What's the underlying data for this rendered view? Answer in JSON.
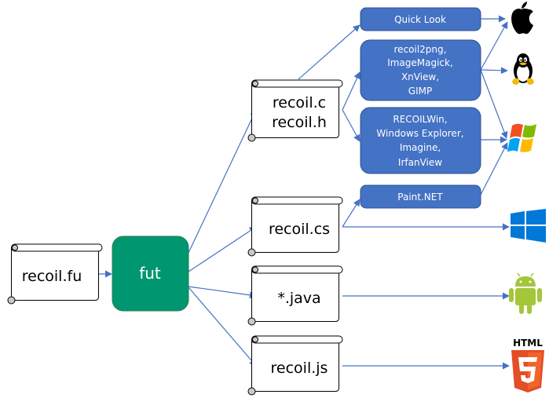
{
  "colors": {
    "arrow": "#4472c4",
    "tool_box_fill": "#4472c4",
    "tool_box_border": "#2f528f",
    "fut_fill": "#009670",
    "scroll_stroke": "#000000",
    "scroll_curl": "#c8c8c8"
  },
  "source": {
    "label": "recoil.fu"
  },
  "compiler": {
    "label": "fut"
  },
  "outputs": [
    {
      "id": "c",
      "lines": [
        "recoil.c",
        "recoil.h"
      ]
    },
    {
      "id": "cs",
      "lines": [
        "recoil.cs"
      ]
    },
    {
      "id": "java",
      "lines": [
        "*.java"
      ]
    },
    {
      "id": "js",
      "lines": [
        "recoil.js"
      ]
    }
  ],
  "tools": [
    {
      "id": "quicklook",
      "lines": [
        "Quick Look"
      ]
    },
    {
      "id": "linux-tools",
      "lines": [
        "recoil2png,",
        "ImageMagick,",
        "XnView,",
        "GIMP"
      ]
    },
    {
      "id": "windows-tools",
      "lines": [
        "RECOILWin,",
        "Windows Explorer,",
        "Imagine,",
        "IrfanView"
      ]
    },
    {
      "id": "paintnet",
      "lines": [
        "Paint.NET"
      ]
    }
  ],
  "platforms": [
    {
      "id": "macos",
      "icon": "apple-icon"
    },
    {
      "id": "linux",
      "icon": "tux-penguin-icon"
    },
    {
      "id": "windows-classic",
      "icon": "windows-flag-icon"
    },
    {
      "id": "windows-modern",
      "icon": "windows-10-icon"
    },
    {
      "id": "android",
      "icon": "android-icon"
    },
    {
      "id": "html5",
      "icon": "html5-icon",
      "label": "HTML",
      "badge": "5"
    }
  ]
}
